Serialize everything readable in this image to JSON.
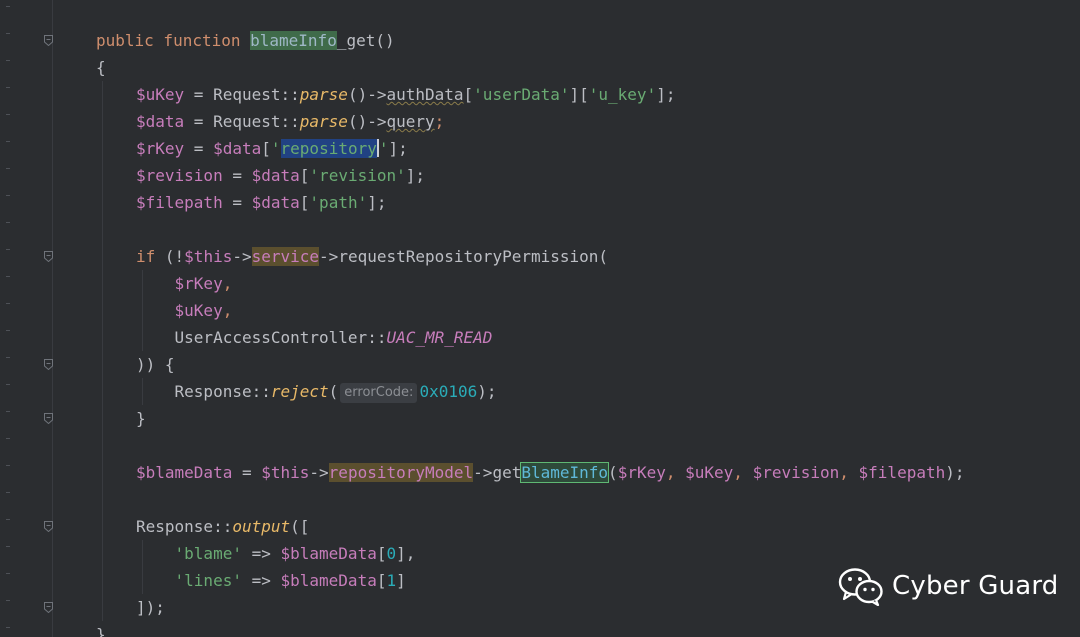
{
  "colors": {
    "background": "#2b2d30",
    "keyword": "#cf8e6d",
    "variable": "#c77dbb",
    "string": "#6aab73",
    "number": "#2aacb8",
    "function_call": "#e8b968",
    "text": "#bcbec4"
  },
  "editor": {
    "lines": [
      {
        "tokens": [
          [
            "kw",
            "public function "
          ],
          [
            "hl-green",
            "blameInfo"
          ],
          [
            "fn",
            "_get()"
          ]
        ]
      },
      {
        "tokens": [
          [
            "punc",
            "{"
          ]
        ]
      },
      {
        "tokens": [
          [
            "var",
            "$uKey"
          ],
          [
            "punc",
            " = Request::"
          ],
          [
            "ital",
            "parse"
          ],
          [
            "punc",
            "()->"
          ],
          [
            "prop-u",
            "authData"
          ],
          [
            "punc",
            "["
          ],
          [
            "str",
            "'userData'"
          ],
          [
            "punc",
            "]["
          ],
          [
            "str",
            "'u_key'"
          ],
          [
            "punc",
            "];"
          ]
        ]
      },
      {
        "tokens": [
          [
            "var",
            "$data"
          ],
          [
            "punc",
            " = Request::"
          ],
          [
            "ital",
            "parse"
          ],
          [
            "punc",
            "()->"
          ],
          [
            "prop-u",
            "query"
          ],
          [
            "kw",
            ";"
          ]
        ]
      },
      {
        "tokens": [
          [
            "var",
            "$rKey"
          ],
          [
            "punc",
            " = "
          ],
          [
            "var",
            "$data"
          ],
          [
            "punc",
            "["
          ],
          [
            "str",
            "'"
          ],
          [
            "hl-sel",
            "repository"
          ],
          [
            "caret",
            ""
          ],
          [
            "str",
            "'"
          ],
          [
            "punc",
            "];"
          ]
        ],
        "current": true
      },
      {
        "tokens": [
          [
            "var",
            "$revision"
          ],
          [
            "punc",
            " = "
          ],
          [
            "var",
            "$data"
          ],
          [
            "punc",
            "["
          ],
          [
            "str",
            "'revision'"
          ],
          [
            "punc",
            "];"
          ]
        ]
      },
      {
        "tokens": [
          [
            "var",
            "$filepath"
          ],
          [
            "punc",
            " = "
          ],
          [
            "var",
            "$data"
          ],
          [
            "punc",
            "["
          ],
          [
            "str",
            "'path'"
          ],
          [
            "punc",
            "];"
          ]
        ]
      },
      {
        "tokens": []
      },
      {
        "tokens": [
          [
            "kw",
            "if "
          ],
          [
            "punc",
            "(!"
          ],
          [
            "var",
            "$this"
          ],
          [
            "punc",
            "->"
          ],
          [
            "hl-brown",
            "service"
          ],
          [
            "punc",
            "->requestRepositoryPermission("
          ]
        ]
      },
      {
        "tokens": [
          [
            "punc",
            "    "
          ],
          [
            "var",
            "$rKey"
          ],
          [
            "kw",
            ","
          ]
        ]
      },
      {
        "tokens": [
          [
            "punc",
            "    "
          ],
          [
            "var",
            "$uKey"
          ],
          [
            "kw",
            ","
          ]
        ]
      },
      {
        "tokens": [
          [
            "punc",
            "    UserAccessController::"
          ],
          [
            "const",
            "UAC_MR_READ"
          ]
        ]
      },
      {
        "tokens": [
          [
            "punc",
            ")) {"
          ]
        ]
      },
      {
        "tokens": [
          [
            "punc",
            "    Response::"
          ],
          [
            "ital",
            "reject"
          ],
          [
            "punc",
            "("
          ],
          [
            "hint",
            "errorCode:"
          ],
          [
            "num",
            "0x0106"
          ],
          [
            "punc",
            ");"
          ]
        ]
      },
      {
        "tokens": [
          [
            "punc",
            "}"
          ]
        ]
      },
      {
        "tokens": []
      },
      {
        "tokens": [
          [
            "var",
            "$blameData"
          ],
          [
            "punc",
            " = "
          ],
          [
            "var",
            "$this"
          ],
          [
            "punc",
            "->"
          ],
          [
            "hl-brown",
            "repositoryModel"
          ],
          [
            "punc",
            "->get"
          ],
          [
            "hl-box",
            "BlameInfo"
          ],
          [
            "punc",
            "("
          ],
          [
            "var",
            "$rKey"
          ],
          [
            "kw",
            ", "
          ],
          [
            "var",
            "$uKey"
          ],
          [
            "kw",
            ", "
          ],
          [
            "var",
            "$revision"
          ],
          [
            "kw",
            ", "
          ],
          [
            "var",
            "$filepath"
          ],
          [
            "punc",
            ");"
          ]
        ]
      },
      {
        "tokens": []
      },
      {
        "tokens": [
          [
            "punc",
            "Response::"
          ],
          [
            "ital",
            "output"
          ],
          [
            "punc",
            "(["
          ]
        ]
      },
      {
        "tokens": [
          [
            "punc",
            "    "
          ],
          [
            "str",
            "'blame'"
          ],
          [
            "punc",
            " => "
          ],
          [
            "var",
            "$blameData"
          ],
          [
            "punc",
            "["
          ],
          [
            "num",
            "0"
          ],
          [
            "punc",
            "],"
          ]
        ]
      },
      {
        "tokens": [
          [
            "punc",
            "    "
          ],
          [
            "str",
            "'lines'"
          ],
          [
            "punc",
            " => "
          ],
          [
            "var",
            "$blameData"
          ],
          [
            "punc",
            "["
          ],
          [
            "num",
            "1"
          ],
          [
            "punc",
            "]"
          ]
        ]
      },
      {
        "tokens": [
          [
            "punc",
            "]);"
          ]
        ]
      },
      {
        "tokens": [
          [
            "punc",
            "}"
          ]
        ]
      }
    ]
  },
  "watermark": {
    "icon": "wechat-icon",
    "text": "Cyber Guard"
  }
}
